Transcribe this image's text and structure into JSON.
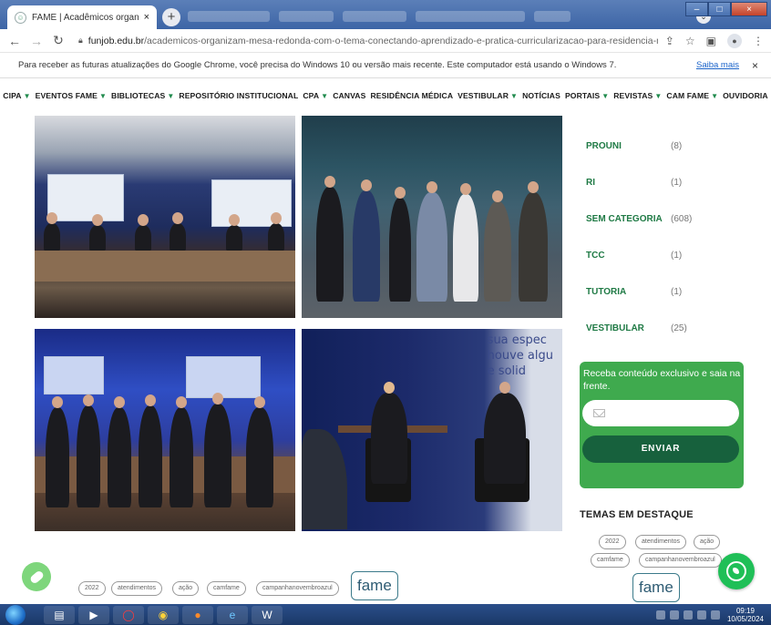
{
  "browser": {
    "tab_title": "FAME | Acadêmicos organizam m",
    "tab_close": "×",
    "new_tab": "+",
    "url_host": "funjob.edu.br",
    "url_path": "/academicos-organizam-mesa-redonda-com-o-tema-conectando-aprendizado-e-pratica-curricularizacao-para-residencia-medica/"
  },
  "infobar": {
    "message": "Para receber as futuras atualizações do Google Chrome, você precisa do Windows 10 ou versão mais recente. Este computador está usando o Windows 7.",
    "link": "Saiba mais",
    "close": "×"
  },
  "nav": {
    "items": [
      {
        "label": "CIPA",
        "dropdown": true
      },
      {
        "label": "EVENTOS FAME",
        "dropdown": true
      },
      {
        "label": "BIBLIOTECAS",
        "dropdown": true
      },
      {
        "label": "REPOSITÓRIO INSTITUCIONAL",
        "dropdown": false
      },
      {
        "label": "CPA",
        "dropdown": true
      },
      {
        "label": "CANVAS",
        "dropdown": false
      },
      {
        "label": "RESIDÊNCIA MÉDICA",
        "dropdown": false
      },
      {
        "label": "VESTIBULAR",
        "dropdown": true
      },
      {
        "label": "NOTÍCIAS",
        "dropdown": false
      },
      {
        "label": "PORTAIS",
        "dropdown": true
      },
      {
        "label": "REVISTAS",
        "dropdown": true
      },
      {
        "label": "CAM FAME",
        "dropdown": true
      },
      {
        "label": "OUVIDORIA",
        "dropdown": false
      }
    ],
    "caret": "▼"
  },
  "photos": {
    "p4_text": "sua espec\nhouve algu\ne solid"
  },
  "categories": [
    {
      "name": "PROUNI",
      "count": "(8)"
    },
    {
      "name": "RI",
      "count": "(1)"
    },
    {
      "name": "SEM CATEGORIA",
      "count": "(608)"
    },
    {
      "name": "TCC",
      "count": "(1)"
    },
    {
      "name": "TUTORIA",
      "count": "(1)"
    },
    {
      "name": "VESTIBULAR",
      "count": "(25)"
    }
  ],
  "newsletter": {
    "text": "Receba conteúdo exclusivo e saia na frente.",
    "button": "ENVIAR"
  },
  "temas": {
    "title": "TEMAS EM DESTAQUE",
    "tags": [
      "2022",
      "atendimentos",
      "ação",
      "camfame",
      "campanhanovembroazul"
    ],
    "big_tag": "fame"
  },
  "post_tags": {
    "tags": [
      "2022",
      "atendimentos",
      "ação",
      "camfame",
      "campanhanovembroazul"
    ],
    "big_tag": "fame"
  },
  "taskbar": {
    "time": "09:19",
    "date": "10/05/2024"
  },
  "colors": {
    "brand_green": "#1f7a45",
    "newsletter_bg": "#3faa4e",
    "button_dark": "#17613d",
    "whatsapp": "#1fbf57"
  }
}
